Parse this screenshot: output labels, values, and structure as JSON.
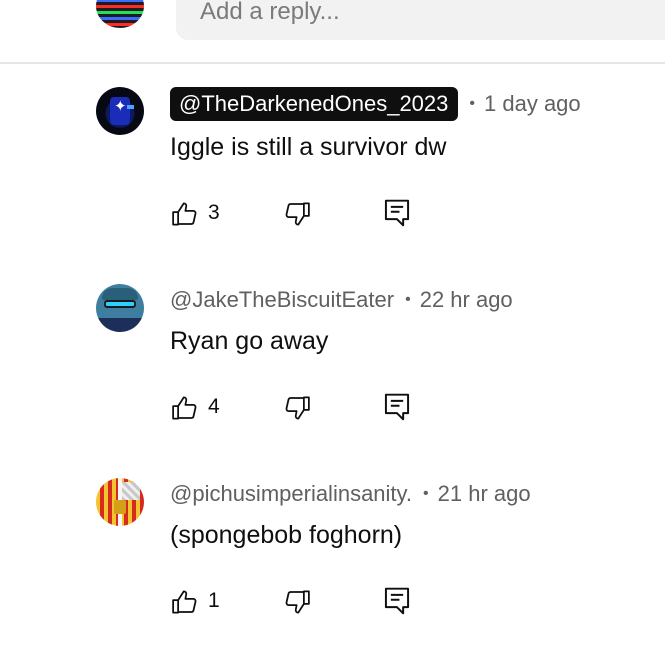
{
  "reply_box": {
    "placeholder": "Add a reply..."
  },
  "comments": [
    {
      "handle": "@TheDarkenedOnes_2023",
      "highlighted": true,
      "separator": "•",
      "time": "1 day ago",
      "text": "Iggle is still a survivor dw",
      "likes": "3"
    },
    {
      "handle": "@JakeTheBiscuitEater",
      "highlighted": false,
      "separator": "•",
      "time": "22 hr ago",
      "text": "Ryan go away",
      "likes": "4"
    },
    {
      "handle": "@pichusimperialinsanity.",
      "highlighted": false,
      "separator": "•",
      "time": "21 hr ago",
      "text": "(spongebob foghorn)",
      "likes": "1"
    }
  ],
  "icons": {
    "like": "thumbs-up-icon",
    "dislike": "thumbs-down-icon",
    "reply": "reply-icon"
  },
  "colors": {
    "text_primary": "#0f0f0f",
    "text_secondary": "#606060",
    "highlight_bg": "#0f0f0f",
    "reply_box_bg": "#f2f2f2",
    "divider": "#e6e6e6"
  }
}
